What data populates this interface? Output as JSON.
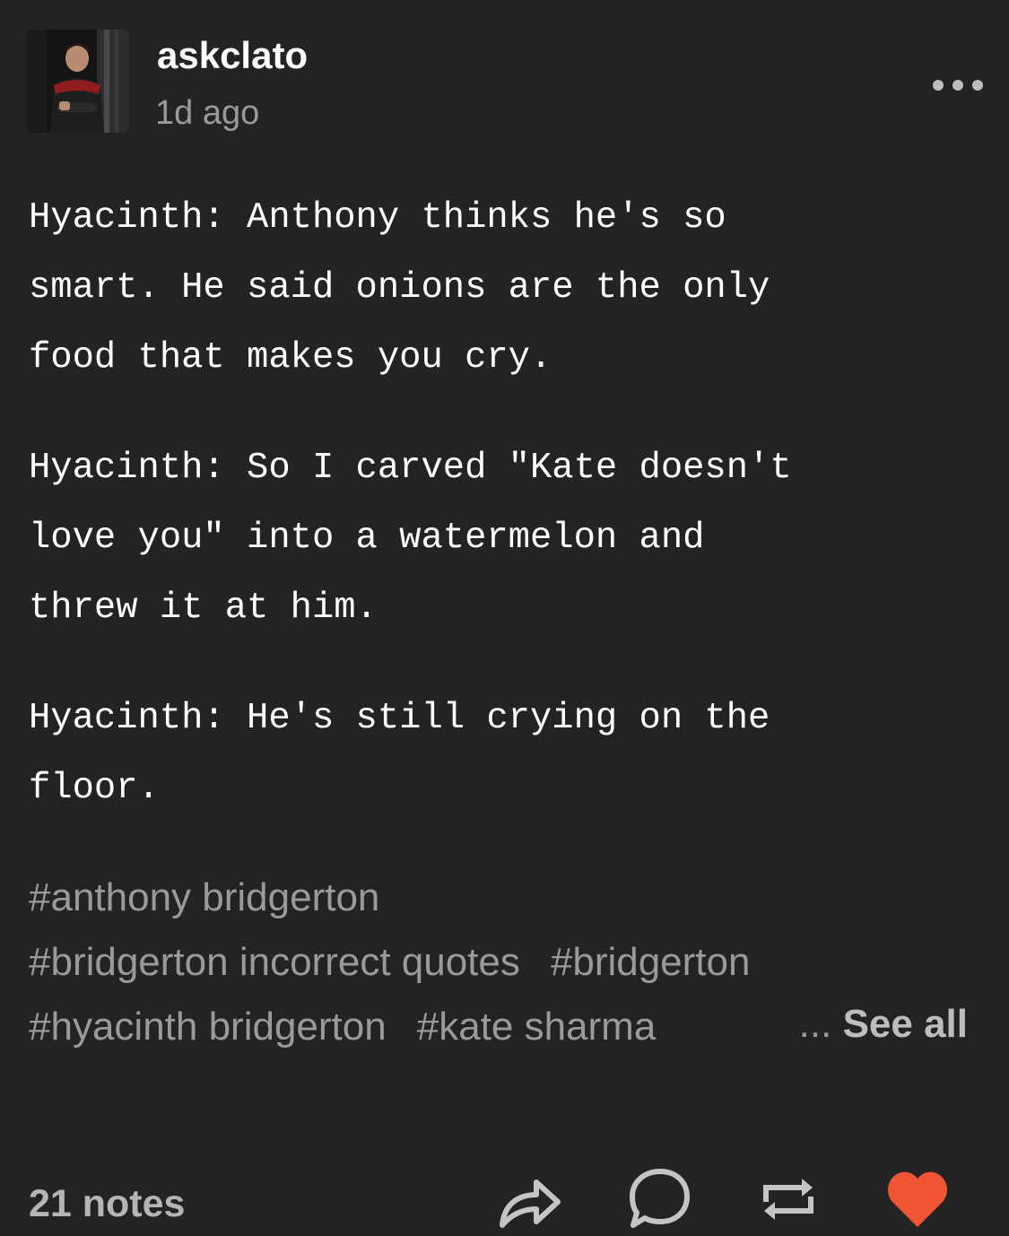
{
  "post": {
    "username": "askclato",
    "timestamp": "1d ago",
    "paragraphs": [
      "Hyacinth: Anthony thinks he's so\nsmart. He said onions are the only\nfood that makes you cry.",
      "Hyacinth: So I carved \"Kate doesn't\nlove you\" into a watermelon and\nthrew it at him.",
      "Hyacinth: He's still crying on the\nfloor."
    ],
    "tags": [
      "#anthony bridgerton",
      "#bridgerton incorrect quotes",
      "#bridgerton",
      "#hyacinth bridgerton",
      "#kate sharma"
    ],
    "see_all_prefix": "...",
    "see_all_label": "See all"
  },
  "footer": {
    "notes": "21 notes"
  },
  "icons": {
    "more": "more-horizontal-icon",
    "share": "share-icon",
    "reply": "reply-icon",
    "reblog": "reblog-icon",
    "like": "heart-icon"
  },
  "colors": {
    "background": "#232323",
    "text": "#ffffff",
    "muted": "#9a9a9a",
    "like_active": "#ef5533"
  }
}
